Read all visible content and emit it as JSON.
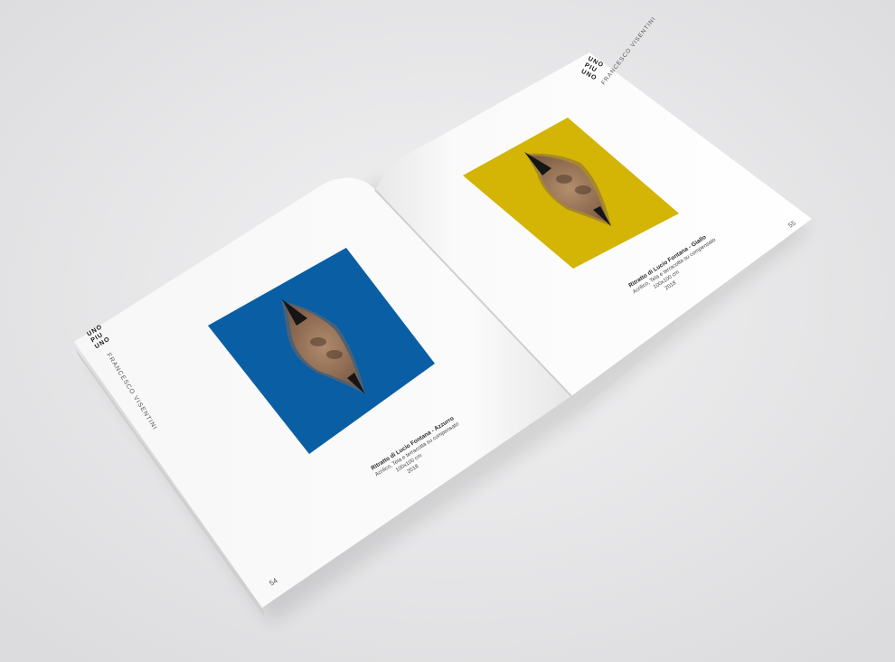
{
  "brand": {
    "logo_lines": [
      "UNO",
      "PIU",
      "UNO"
    ],
    "artist": "FRANCESCO VISENTINI"
  },
  "left_page": {
    "page_number": "54",
    "artwork": {
      "background_color": "#0a5ea4",
      "caption_title": "Ritratto di Lucio Fontana - Azzurro",
      "caption_lines": [
        "Acrilico, Tela e terracotta su compensato",
        "100x100 cm",
        "2018"
      ]
    }
  },
  "right_page": {
    "page_number": "55",
    "artwork": {
      "background_color": "#d4b404",
      "caption_title": "Ritratto di Lucio Fontana - Giallo",
      "caption_lines": [
        "Acrilico, Tela e terracotta su compensato",
        "100x100 cm",
        "2018"
      ]
    }
  }
}
